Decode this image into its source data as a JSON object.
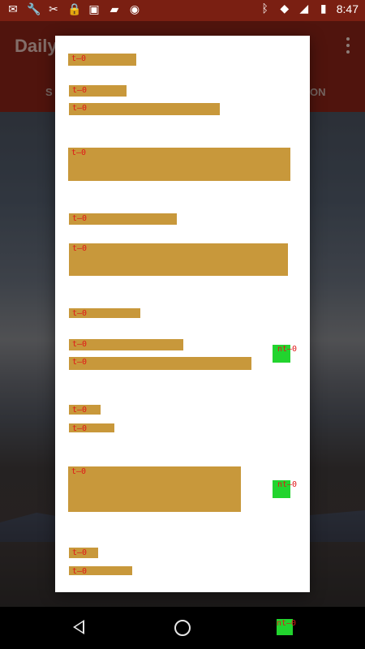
{
  "status_bar": {
    "time": "8:47",
    "left_icons": [
      "mail-icon",
      "wrench-icon",
      "settings-icon",
      "lock-icon",
      "photo-icon",
      "briefcase-icon",
      "android-icon"
    ],
    "right_icons": [
      "bluetooth-icon",
      "wifi-icon",
      "signal-icon",
      "battery-icon"
    ]
  },
  "app_bar": {
    "title": "Daily",
    "tab_left": "S",
    "tab_right": "ON"
  },
  "dialog": {
    "blocks": [
      {
        "label": "t—0"
      },
      {
        "label": "t—0"
      },
      {
        "label": "t—0"
      },
      {
        "label": "t—0"
      },
      {
        "label": "t—0"
      },
      {
        "label": "t—0"
      },
      {
        "label": "t—0"
      },
      {
        "label": "t—0"
      },
      {
        "label": "t—0"
      },
      {
        "label": "t—0"
      },
      {
        "label": "t—0"
      },
      {
        "label": "t—0"
      },
      {
        "label": "t—0"
      },
      {
        "label": "t—0"
      }
    ],
    "green_markers": [
      {
        "label": "nt—0"
      },
      {
        "label": "nt—0"
      }
    ]
  },
  "nav_bar": {
    "recents_marker_label": "nt—0"
  },
  "colors": {
    "placeholder_block": "#c8983b",
    "placeholder_text": "#e01818",
    "marker_green": "#22d42e",
    "app_bar": "#7b2014"
  }
}
